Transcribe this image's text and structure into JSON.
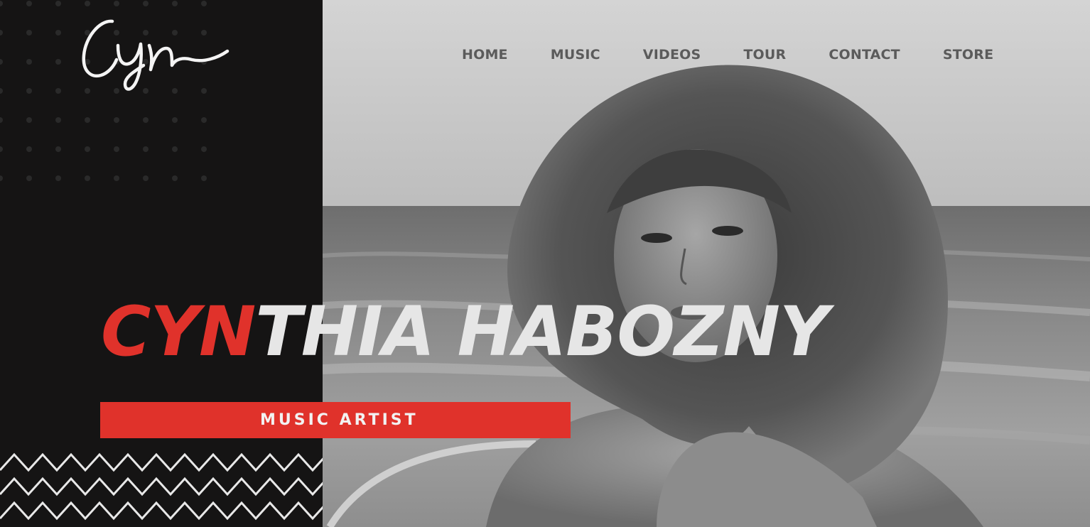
{
  "brand": {
    "logo_text": "Cyn"
  },
  "nav": {
    "items": [
      {
        "label": "HOME"
      },
      {
        "label": "MUSIC"
      },
      {
        "label": "VIDEOS"
      },
      {
        "label": "TOUR"
      },
      {
        "label": "CONTACT"
      },
      {
        "label": "STORE"
      }
    ]
  },
  "hero": {
    "name_accent": "CYN",
    "name_rest": "THIA HABOZNY",
    "subtitle": "MUSIC ARTIST",
    "accent_color": "#e0322b"
  }
}
